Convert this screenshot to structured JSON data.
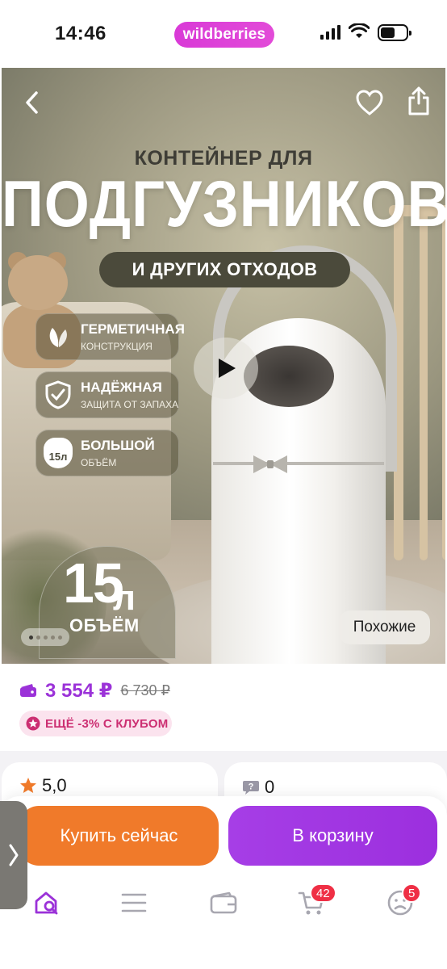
{
  "status_bar": {
    "time": "14:46",
    "brand": "wildberries"
  },
  "hero": {
    "title_small": "КОНТЕЙНЕР ДЛЯ",
    "title_big": "ПОДГУЗНИКОВ",
    "subtitle": "И ДРУГИХ ОТХОДОВ",
    "features": [
      {
        "icon": "leaves-icon",
        "title": "ГЕРМЕТИЧНАЯ",
        "subtitle": "КОНСТРУКЦИЯ"
      },
      {
        "icon": "shield-check-icon",
        "title": "НАДЁЖНАЯ",
        "subtitle": "ЗАЩИТА ОТ ЗАПАХА"
      },
      {
        "icon": "bag-15l-icon",
        "title": "БОЛЬШОЙ",
        "subtitle": "ОБЪЁМ",
        "icon_text": "15л"
      }
    ],
    "volume": {
      "number": "15",
      "unit": "л",
      "label": "ОБЪЁМ"
    },
    "similar_label": "Похожие",
    "slide_count": 5,
    "active_slide": 0
  },
  "product": {
    "price": "3 554 ₽",
    "old_price": "6 730 ₽",
    "club_offer": "ЕЩЁ -3% С КЛУБОМ",
    "rating": "5,0",
    "questions": "0"
  },
  "actions": {
    "buy_now": "Купить сейчас",
    "to_cart": "В корзину"
  },
  "tabbar": {
    "cart_badge": "42",
    "profile_badge": "5"
  },
  "colors": {
    "brand": "#d93ad7",
    "price": "#9b32d8",
    "buy_now": "#f07a2a",
    "to_cart": "#a63ee6",
    "club": "#cc2f72",
    "badge": "#ef2f45"
  }
}
